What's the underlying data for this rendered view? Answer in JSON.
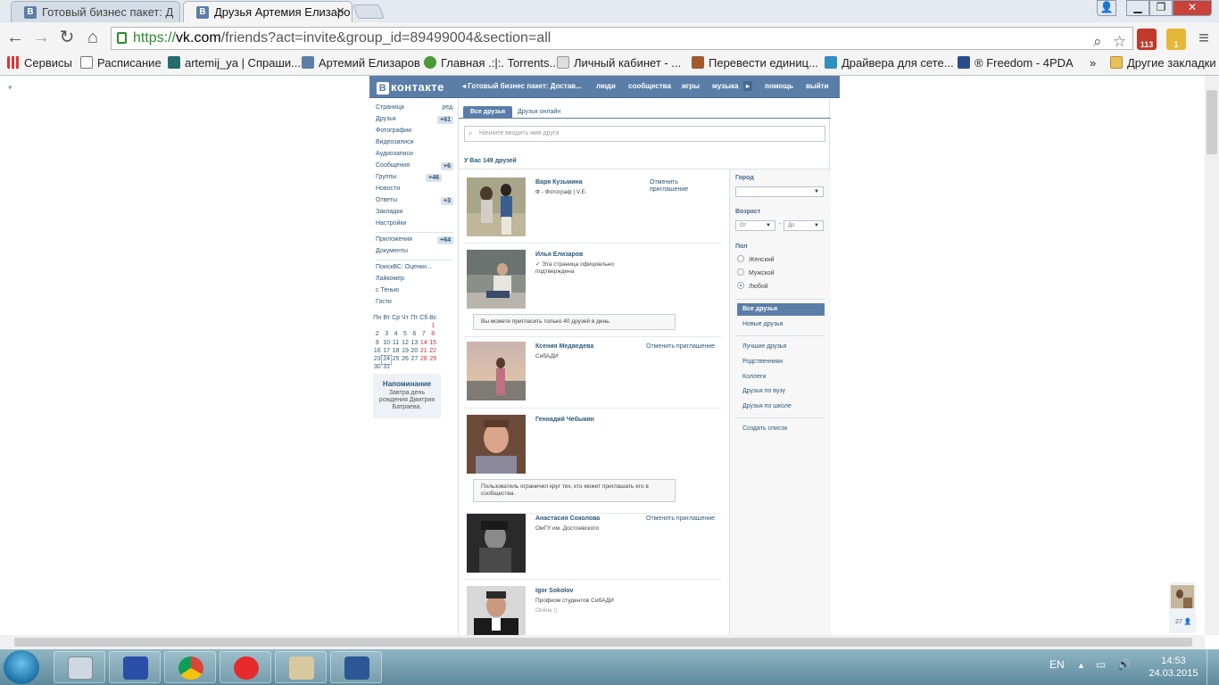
{
  "browser": {
    "tabs": [
      {
        "title": "Готовый бизнес пакет: Д"
      },
      {
        "title": "Друзья Артемия Елизаро"
      }
    ],
    "url": {
      "scheme": "https://",
      "host": "vk.com",
      "path": "/friends?act=invite&group_id=89499004&section=all"
    },
    "extensions": [
      "113",
      "1"
    ],
    "bookmarks": [
      {
        "label": "Сервисы",
        "icon": "apps-grid-icon"
      },
      {
        "label": "Расписание",
        "icon": "page-icon"
      },
      {
        "label": "artemij_ya | Спраши...",
        "icon": "ask-icon"
      },
      {
        "label": "Артемий Елизаров",
        "icon": "vk-icon"
      },
      {
        "label": "Главная .:|:. Torrents...",
        "icon": "torrent-icon"
      },
      {
        "label": "Личный кабинет - ...",
        "icon": "cabinet-icon"
      },
      {
        "label": "Перевести единиц...",
        "icon": "convert-icon"
      },
      {
        "label": "Драйвера для сете...",
        "icon": "drivers-icon"
      },
      {
        "label": "® Freedom - 4PDA",
        "icon": "4pda-icon"
      },
      {
        "label": "»",
        "icon": ""
      },
      {
        "label": "Другие закладки",
        "icon": "folder-icon"
      }
    ]
  },
  "vk": {
    "header": {
      "logo": "контакте",
      "crumb": "Готовый бизнес пакет: Достав...",
      "links": [
        "люди",
        "сообщества",
        "игры",
        "музыка",
        "помощь",
        "выйти"
      ]
    },
    "menu": [
      {
        "label": "Страница",
        "extra": "ред."
      },
      {
        "label": "Друзья",
        "badge": "+61"
      },
      {
        "label": "Фотографии"
      },
      {
        "label": "Видеозаписи"
      },
      {
        "label": "Аудиозаписи"
      },
      {
        "label": "Сообщения",
        "badge": "+6"
      },
      {
        "label": "Группы",
        "badge": "+46"
      },
      {
        "label": "Новости"
      },
      {
        "label": "Ответы",
        "badge": "+3"
      },
      {
        "label": "Закладки"
      },
      {
        "label": "Настройки"
      }
    ],
    "apps": [
      {
        "label": "Приложения",
        "badge": "+64"
      },
      {
        "label": "Документы"
      }
    ],
    "app_links": [
      "ПоискВС: Оценки...",
      "Лайкомер",
      "с Тенью",
      "Гости"
    ],
    "calendar": {
      "weekdays": [
        "Пн",
        "Вт",
        "Ср",
        "Чт",
        "Пт",
        "Сб",
        "Вс"
      ],
      "weeks": [
        [
          "",
          "",
          "",
          "",
          "",
          "",
          "1"
        ],
        [
          "2",
          "3",
          "4",
          "5",
          "6",
          "7",
          "8"
        ],
        [
          "9",
          "10",
          "11",
          "12",
          "13",
          "14",
          "15"
        ],
        [
          "16",
          "17",
          "18",
          "19",
          "20",
          "21",
          "22"
        ],
        [
          "23",
          "24",
          "25",
          "26",
          "27",
          "28",
          "29"
        ],
        [
          "30",
          "31",
          "",
          "",
          "",
          "",
          ""
        ]
      ],
      "today": "24"
    },
    "reminder": {
      "title": "Напоминание",
      "text": "Завтра день рождения Дмитрия Батраева."
    },
    "tabs": [
      "Все друзья",
      "Друзья онлайн"
    ],
    "search_placeholder": "Начните вводить имя друга",
    "count": "У Вас 149 друзей",
    "friends": [
      {
        "name": "Варя Кузьмина",
        "sub": "Ф - Фотограф | V.E.",
        "action": "Отменить приглашение",
        "notice": ""
      },
      {
        "name": "Илья Елизаров",
        "sub": "✓ Эта страница официально подтверждена",
        "action": "",
        "notice": "Вы можете пригласить только 40 друзей в день."
      },
      {
        "name": "Ксения Медведева",
        "sub": "СибАДИ",
        "action": "Отменить приглашение",
        "notice": ""
      },
      {
        "name": "Геннадий Чебыкин",
        "sub": "",
        "action": "",
        "notice": "Пользователь ограничил круг тех, кто может приглашать его в сообщества."
      },
      {
        "name": "Анастасия Соколова",
        "sub": "ОмГУ им. Достоевского",
        "action": "Отменить приглашение",
        "notice": ""
      },
      {
        "name": "Igor Sokolov",
        "sub": "Профком студентов СибАДИ",
        "online": "Online",
        "action": "",
        "notice": ""
      }
    ],
    "filters": {
      "city_label": "Город",
      "age_label": "Возраст",
      "age_from": "От",
      "age_dash": "-",
      "age_to": "До",
      "sex_label": "Пол",
      "sex_options": [
        "Женский",
        "Мужской",
        "Любой"
      ],
      "sex_selected": "Любой",
      "lists_top": [
        "Все друзья",
        "Новые друзья"
      ],
      "lists": [
        "Лучшие друзья",
        "Родственники",
        "Коллеги",
        "Друзья по вузу",
        "Друзья по школе"
      ],
      "create": "Создать список"
    },
    "minichat_count": "27"
  },
  "taskbar": {
    "lang": "EN",
    "time": "14:53",
    "date": "24.03.2015"
  },
  "colors": {
    "vk_blue": "#5b7ea8",
    "link": "#2b587a"
  }
}
